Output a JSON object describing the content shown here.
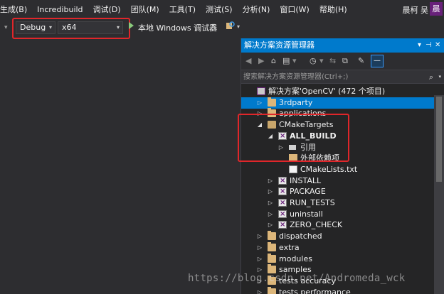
{
  "menubar": {
    "items": [
      "生成(B)",
      "Incredibuild",
      "调试(D)",
      "团队(M)",
      "工具(T)",
      "测试(S)",
      "分析(N)",
      "窗口(W)",
      "帮助(H)"
    ],
    "user": "晨柯 吴",
    "avatar": "晨"
  },
  "toolbar": {
    "configuration": "Debug",
    "platform": "x64",
    "run_label": "本地 Windows 调试器"
  },
  "explorer": {
    "title": "解决方案资源管理器",
    "search_placeholder": "搜索解决方案资源管理器(Ctrl+;)",
    "tree": [
      {
        "label": "解决方案'OpenCV' (472 个项目)",
        "depth": 0,
        "exp": "",
        "icon": "sln"
      },
      {
        "label": "3rdparty",
        "depth": 1,
        "exp": "▷",
        "icon": "folder",
        "selected": true
      },
      {
        "label": "applications",
        "depth": 1,
        "exp": "▷",
        "icon": "folder"
      },
      {
        "label": "CMakeTargets",
        "depth": 1,
        "exp": "◢",
        "icon": "folder-open"
      },
      {
        "label": "ALL_BUILD",
        "depth": 2,
        "exp": "◢",
        "icon": "proj",
        "bold": true
      },
      {
        "label": "引用",
        "depth": 3,
        "exp": "▷",
        "icon": "refs"
      },
      {
        "label": "外部依赖项",
        "depth": 3,
        "exp": "",
        "icon": "deps"
      },
      {
        "label": "CMakeLists.txt",
        "depth": 3,
        "exp": "",
        "icon": "txt"
      },
      {
        "label": "INSTALL",
        "depth": 2,
        "exp": "▷",
        "icon": "proj"
      },
      {
        "label": "PACKAGE",
        "depth": 2,
        "exp": "▷",
        "icon": "proj"
      },
      {
        "label": "RUN_TESTS",
        "depth": 2,
        "exp": "▷",
        "icon": "proj"
      },
      {
        "label": "uninstall",
        "depth": 2,
        "exp": "▷",
        "icon": "proj"
      },
      {
        "label": "ZERO_CHECK",
        "depth": 2,
        "exp": "▷",
        "icon": "proj"
      },
      {
        "label": "dispatched",
        "depth": 1,
        "exp": "▷",
        "icon": "folder"
      },
      {
        "label": "extra",
        "depth": 1,
        "exp": "▷",
        "icon": "folder"
      },
      {
        "label": "modules",
        "depth": 1,
        "exp": "▷",
        "icon": "folder"
      },
      {
        "label": "samples",
        "depth": 1,
        "exp": "▷",
        "icon": "folder"
      },
      {
        "label": "tests accuracy",
        "depth": 1,
        "exp": "▷",
        "icon": "folder"
      },
      {
        "label": "tests performance",
        "depth": 1,
        "exp": "▷",
        "icon": "folder"
      }
    ]
  },
  "watermark": "https://blog.csdn.net/Andromeda_wck",
  "colors": {
    "accent": "#007acc",
    "highlight": "#e0262a",
    "background": "#2d2d30"
  }
}
